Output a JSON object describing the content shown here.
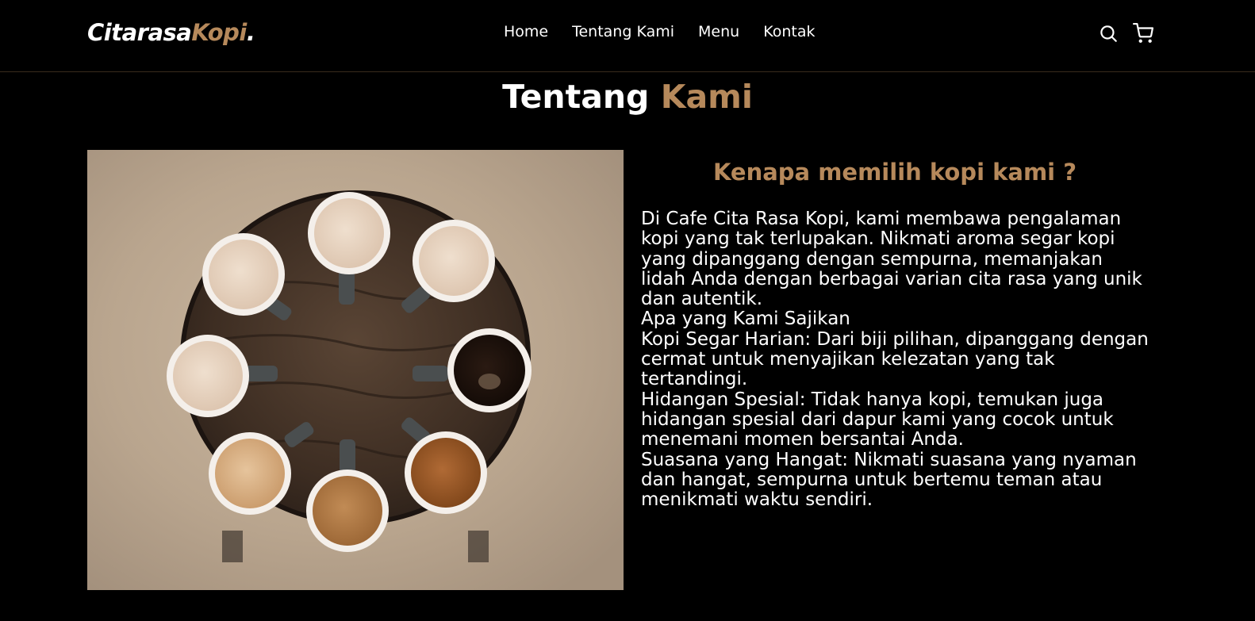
{
  "navbar": {
    "logo_main": "Citarasa",
    "logo_accent": "Kopi",
    "logo_dot": ".",
    "links": [
      {
        "label": "Home"
      },
      {
        "label": "Tentang Kami"
      },
      {
        "label": "Menu"
      },
      {
        "label": "Kontak"
      }
    ],
    "icons": [
      "search-icon",
      "shopping-cart-icon"
    ]
  },
  "about": {
    "title_main": "Tentang",
    "title_accent": "Kami",
    "image_alt": "cups of coffee on a round wooden table",
    "heading": "Kenapa memilih kopi kami ?",
    "paragraphs": [
      "Di Cafe Cita Rasa Kopi, kami membawa pengalaman kopi yang tak terlupakan. Nikmati aroma segar kopi yang dipanggang dengan sempurna, memanjakan lidah Anda dengan berbagai varian cita rasa yang unik dan autentik.",
      "Apa yang Kami Sajikan",
      "Kopi Segar Harian: Dari biji pilihan, dipanggang dengan cermat untuk menyajikan kelezatan yang tak tertandingi.",
      "Hidangan Spesial: Tidak hanya kopi, temukan juga hidangan spesial dari dapur kami yang cocok untuk menemani momen bersantai Anda.",
      "Suasana yang Hangat: Nikmati suasana yang nyaman dan hangat, sempurna untuk bertemu teman atau menikmati waktu sendiri."
    ]
  },
  "colors": {
    "background": "#000000",
    "accent": "#b6895b",
    "text": "#ffffff"
  }
}
